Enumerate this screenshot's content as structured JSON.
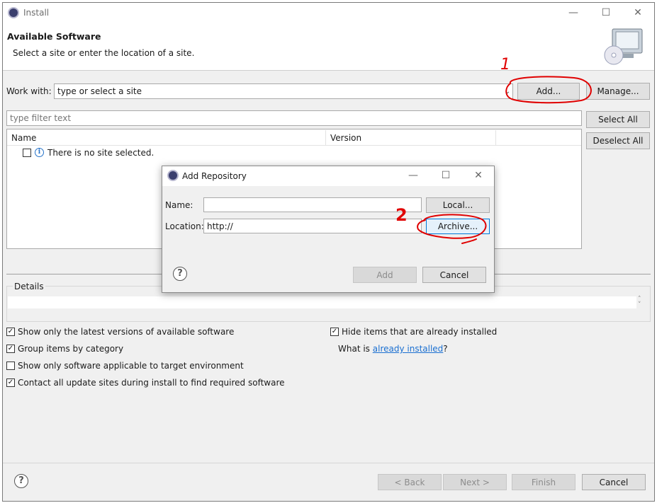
{
  "window": {
    "title": "Install"
  },
  "header": {
    "title": "Available Software",
    "subtitle": "Select a site or enter the location of a site."
  },
  "work_with": {
    "label": "Work with:",
    "value": "type or select a site",
    "add_label": "Add...",
    "manage_label": "Manage..."
  },
  "filter": {
    "placeholder": "type filter text"
  },
  "side_buttons": {
    "select_all": "Select All",
    "deselect_all": "Deselect All"
  },
  "table": {
    "columns": [
      "Name",
      "Version"
    ],
    "rows": [
      {
        "name": "There is no site selected.",
        "checked": false
      }
    ]
  },
  "details": {
    "label": "Details"
  },
  "options": {
    "show_latest": {
      "label": "Show only the latest versions of available software",
      "checked": true
    },
    "group_by_category": {
      "label": "Group items by category",
      "checked": true
    },
    "show_applicable": {
      "label": "Show only software applicable to target environment",
      "checked": false
    },
    "contact_sites": {
      "label": "Contact all update sites during install to find required software",
      "checked": true
    },
    "hide_installed": {
      "label": "Hide items that are already installed",
      "checked": true
    },
    "what_is_prefix": "What is ",
    "what_is_link": "already installed",
    "what_is_suffix": "?"
  },
  "footer": {
    "back": "< Back",
    "next": "Next >",
    "finish": "Finish",
    "cancel": "Cancel"
  },
  "dialog": {
    "title": "Add Repository",
    "name_label": "Name:",
    "name_value": "",
    "location_label": "Location:",
    "location_value": "http://",
    "local_label": "Local...",
    "archive_label": "Archive...",
    "add_label": "Add",
    "cancel_label": "Cancel"
  },
  "annotations": {
    "mark_1": "1",
    "mark_2": "2"
  },
  "colors": {
    "annotation": "#e00000",
    "link": "#1a6fd1",
    "focus": "#0078d7"
  },
  "icons": [
    "eclipse-app-icon",
    "minimize-icon",
    "maximize-icon",
    "close-icon",
    "install-wizard-icon",
    "info-icon",
    "help-icon",
    "combo-arrow-icon"
  ]
}
